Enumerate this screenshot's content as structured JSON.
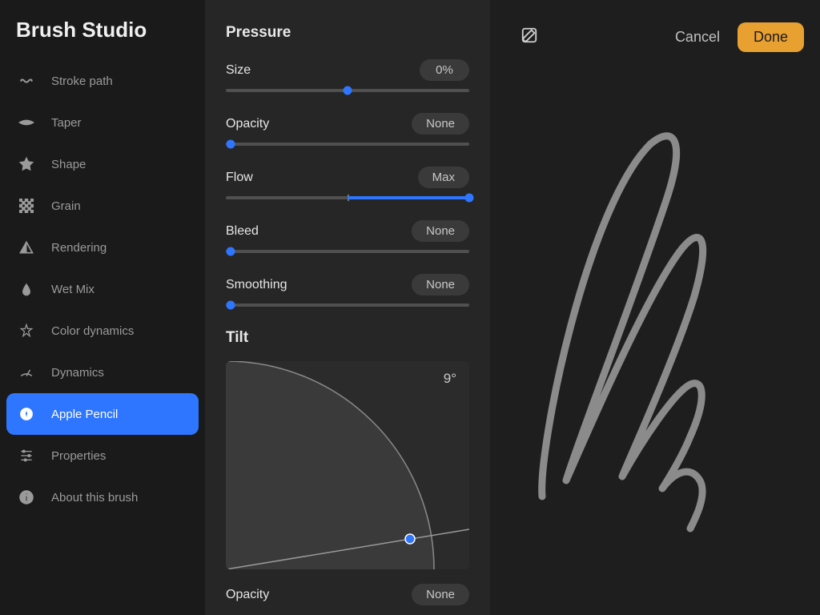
{
  "app_title": "Brush Studio",
  "sidebar": {
    "items": [
      {
        "id": "stroke-path",
        "label": "Stroke path",
        "icon": "stroke-path-icon"
      },
      {
        "id": "taper",
        "label": "Taper",
        "icon": "taper-icon"
      },
      {
        "id": "shape",
        "label": "Shape",
        "icon": "shape-icon"
      },
      {
        "id": "grain",
        "label": "Grain",
        "icon": "grain-icon"
      },
      {
        "id": "rendering",
        "label": "Rendering",
        "icon": "rendering-icon"
      },
      {
        "id": "wet-mix",
        "label": "Wet Mix",
        "icon": "wet-mix-icon"
      },
      {
        "id": "color-dynamics",
        "label": "Color dynamics",
        "icon": "color-dynamics-icon"
      },
      {
        "id": "dynamics",
        "label": "Dynamics",
        "icon": "dynamics-icon"
      },
      {
        "id": "apple-pencil",
        "label": "Apple Pencil",
        "icon": "apple-pencil-icon",
        "selected": true
      },
      {
        "id": "properties",
        "label": "Properties",
        "icon": "properties-icon"
      },
      {
        "id": "about",
        "label": "About this brush",
        "icon": "about-icon"
      }
    ]
  },
  "settings": {
    "pressure": {
      "title": "Pressure",
      "sliders": [
        {
          "id": "size",
          "label": "Size",
          "value_label": "0%",
          "percent": 50,
          "track_mode": "center"
        },
        {
          "id": "opacity",
          "label": "Opacity",
          "value_label": "None",
          "percent": 2,
          "track_mode": "left"
        },
        {
          "id": "flow",
          "label": "Flow",
          "value_label": "Max",
          "percent": 100,
          "track_mode": "center-fill"
        },
        {
          "id": "bleed",
          "label": "Bleed",
          "value_label": "None",
          "percent": 2,
          "track_mode": "left"
        },
        {
          "id": "smoothing",
          "label": "Smoothing",
          "value_label": "None",
          "percent": 2,
          "track_mode": "left"
        }
      ]
    },
    "tilt": {
      "title": "Tilt",
      "angle_label": "9°",
      "angle_deg": 9,
      "opacity_label": "Opacity",
      "opacity_value_label": "None"
    }
  },
  "preview": {
    "cancel_label": "Cancel",
    "done_label": "Done"
  },
  "colors": {
    "accent": "#2e76ff",
    "done_button": "#e8a030"
  }
}
